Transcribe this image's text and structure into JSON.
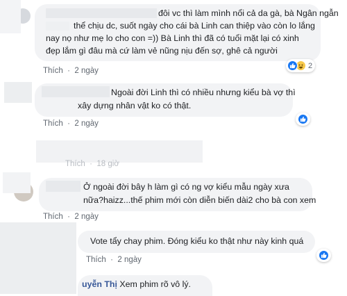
{
  "colors": {
    "bubble": "#f2f3f5",
    "link": "#385898",
    "meta": "#606770",
    "like": "#1877f2",
    "haha": "#f7c94b"
  },
  "comments": [
    {
      "lines": [
        "đôi vc thì làm mình nổi cả da gà, bà Ngân ngẫn",
        "thể chịu dc, suốt ngày cho cái bà Linh can thiệp vào còn lo lắng",
        "nay nọ như mẹ lo cho con =)) Bà Linh thì đã có tuổi mặt lại có xinh",
        "đẹp lắm gì đâu mà cứ làm vẻ nũng nịu đến sợ, ghê cả người"
      ],
      "action": "Thích",
      "time": "2 ngày",
      "reaction_icons": [
        "thumbs-up-icon",
        "laughing-face-icon"
      ],
      "reaction_count": "2"
    },
    {
      "lines": [
        "Ngoài đời Linh thì có nhiều nhưng kiểu bà vợ thì",
        "xây dựng nhân vật ko có thật."
      ],
      "action": "Thích",
      "time": "2 ngày",
      "reaction_icons": [
        "thumbs-up-icon"
      ]
    },
    {
      "action": "Thích",
      "time": "18 giờ"
    },
    {
      "lines": [
        "Ở ngoài đời bây h làm gì có ng vợ kiểu mẫu ngày xưa",
        "nữa?haizz...thế phim mới còn diễn biến dài2 cho bà con xem"
      ],
      "action": "Thích",
      "time": "2 ngày"
    },
    {
      "lines": [
        "Vote tẩy chay phim. Đóng kiểu ko thật như này kinh quá"
      ],
      "action": "Thích",
      "time": "2 ngày",
      "reaction_icons": [
        "thumbs-up-icon"
      ]
    },
    {
      "author": "uyễn Thị",
      "text": "Xem phim rõ vô lý."
    }
  ]
}
